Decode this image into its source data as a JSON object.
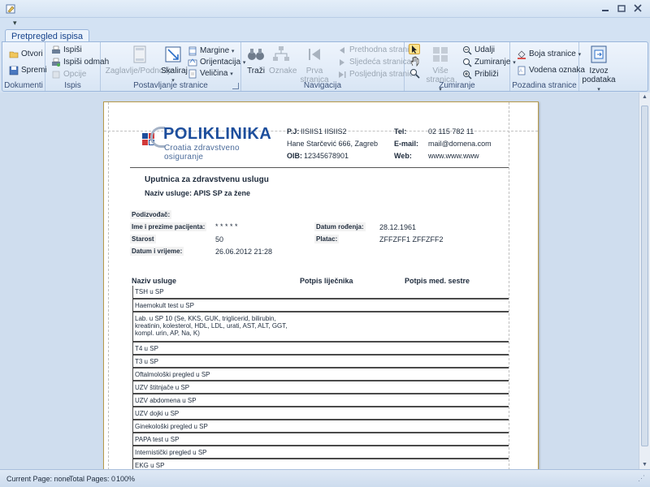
{
  "window": {
    "qat_label": "▾"
  },
  "tab": {
    "label": "Pretpregled ispisa"
  },
  "ribbon": {
    "dokumenti": {
      "label": "Dokumenti",
      "open": "Otvori",
      "save": "Spremi"
    },
    "ispis": {
      "label": "Ispis",
      "print": "Ispiši",
      "print_now": "Ispiši odmah",
      "options": "Opcije"
    },
    "postavljanje": {
      "label": "Postavljanje stranice",
      "header_footer": "Zaglavlje/Podnožje",
      "scale": "Skaliraj",
      "margins": "Margine",
      "orientation": "Orijentacija",
      "size": "Veličina"
    },
    "navigacija": {
      "label": "Navigacija",
      "find": "Traži",
      "bookmarks": "Oznake",
      "first_page": "Prva stranica",
      "prev_page": "Prethodna stranica",
      "next_page": "Sljedeća stranica",
      "last_page": "Posljednja stranica"
    },
    "zumiranje": {
      "label": "Zumiranje",
      "more_pages": "Više stranica",
      "zoom_out": "Udalji",
      "zoom": "Zumiranje",
      "zoom_in": "Približi"
    },
    "pozadina": {
      "label": "Pozadina stranice",
      "page_color": "Boja stranice",
      "watermark": "Vodena oznaka"
    },
    "izvoz": {
      "label": "Izvoz podataka"
    }
  },
  "document": {
    "logo": {
      "main": "POLIKLINIKA",
      "sub": "Croatia zdravstveno osiguranje"
    },
    "header": {
      "pj_label": "P.J:",
      "pj_value": "IISIIS1 IISIIS2",
      "address": "Hane Starčević 666, Zagreb",
      "oib_label": "OIB:",
      "oib_value": "12345678901",
      "tel_label": "Tel:",
      "tel_value": "02 115 782 11",
      "email_label": "E-mail:",
      "email_value": "mail@domena.com",
      "web_label": "Web:",
      "web_value": "www.www.www"
    },
    "title": "Uputnica za zdravstvenu uslugu",
    "service_name": "Naziv usluge: APIS SP za žene",
    "fields": {
      "podizvodac_label": "Podizvođač:",
      "patient_label": "Ime i prezime pacijenta:",
      "patient_value": "* * * * *",
      "age_label": "Starost",
      "age_value": "50",
      "datetime_label": "Datum i vrijeme:",
      "datetime_value": "26.06.2012 21:28",
      "dob_label": "Datum rođenja:",
      "dob_value": "28.12.1961",
      "payer_label": "Platac:",
      "payer_value": "ZFFZFF1 ZFFZFF2"
    },
    "table": {
      "col_service": "Naziv usluge",
      "col_doctor": "Potpis liječnika",
      "col_nurse": "Potpis med. sestre",
      "rows": [
        "TSH u SP",
        "Haemokult test u SP",
        "Lab. u SP 10 (Se, KKS, GUK, triglicerid, bilirubin, kreatinin, kolesterol, HDL, LDL, urati, AST, ALT, GGT, kompl. urin, AP, Na, K)",
        "T4 u SP",
        "T3 u SP",
        "Oftalmološki pregled u SP",
        "UZV štitnjače u SP",
        "UZV abdomena u SP",
        "UZV dojki u SP",
        "Ginekološki pregled u SP",
        "PAPA test u SP",
        "Internistički pregled u SP",
        "EKG u SP"
      ]
    }
  },
  "status": {
    "current_page": "Current Page: none",
    "total_pages": "Total Pages: 0",
    "zoom": "100%"
  }
}
